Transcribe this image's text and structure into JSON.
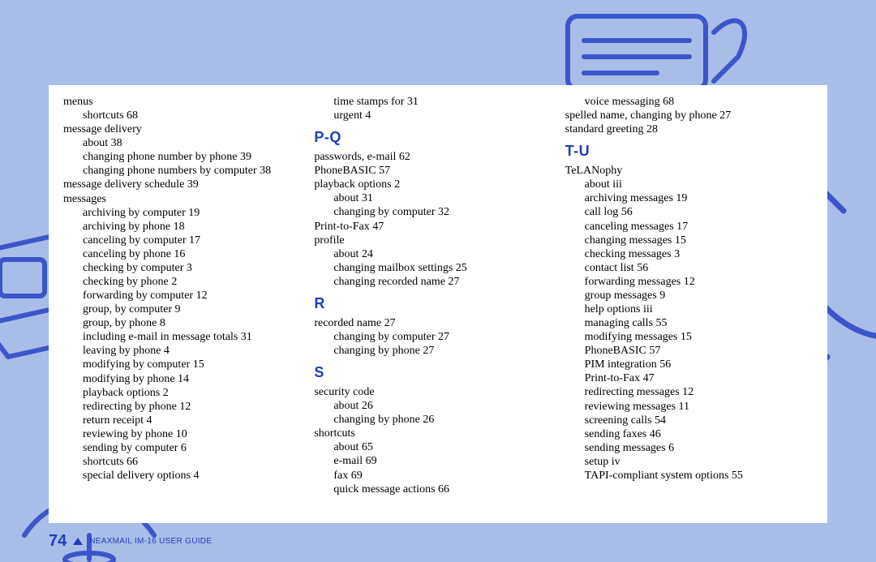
{
  "footer": {
    "pageNumber": "74",
    "guide": "NEAXMAIL IM-16 USER GUIDE"
  },
  "headings": {
    "pq": "P-Q",
    "r": "R",
    "s": "S",
    "tu": "T-U"
  },
  "col1": [
    {
      "text": "menus",
      "indent": 0
    },
    {
      "text": "shortcuts 68",
      "indent": 1
    },
    {
      "text": "message delivery",
      "indent": 0
    },
    {
      "text": "about 38",
      "indent": 1
    },
    {
      "text": "changing phone number by phone 39",
      "indent": 1
    },
    {
      "text": "changing phone numbers by computer 38",
      "indent": 1
    },
    {
      "text": "message delivery schedule 39",
      "indent": 0
    },
    {
      "text": "messages",
      "indent": 0
    },
    {
      "text": "archiving by computer 19",
      "indent": 1
    },
    {
      "text": "archiving by phone 18",
      "indent": 1
    },
    {
      "text": "canceling by computer 17",
      "indent": 1
    },
    {
      "text": "canceling by phone 16",
      "indent": 1
    },
    {
      "text": "checking by computer 3",
      "indent": 1
    },
    {
      "text": "checking by phone 2",
      "indent": 1
    },
    {
      "text": "forwarding by computer 12",
      "indent": 1
    },
    {
      "text": "group, by computer 9",
      "indent": 1
    },
    {
      "text": "group, by phone 8",
      "indent": 1
    },
    {
      "text": "including e-mail in message totals 31",
      "indent": 1
    },
    {
      "text": "leaving by phone 4",
      "indent": 1
    },
    {
      "text": "modifying by computer 15",
      "indent": 1
    },
    {
      "text": "modifying by phone 14",
      "indent": 1
    },
    {
      "text": "playback options 2",
      "indent": 1
    },
    {
      "text": "redirecting by phone 12",
      "indent": 1
    },
    {
      "text": "return receipt 4",
      "indent": 1
    },
    {
      "text": "reviewing by phone 10",
      "indent": 1
    },
    {
      "text": "sending by computer 6",
      "indent": 1
    },
    {
      "text": "shortcuts 66",
      "indent": 1
    },
    {
      "text": "special delivery options 4",
      "indent": 1
    }
  ],
  "col2_a": [
    {
      "text": "time stamps for 31",
      "indent": 1
    },
    {
      "text": "urgent 4",
      "indent": 1
    }
  ],
  "col2_pq": [
    {
      "text": "passwords, e-mail 62",
      "indent": 0
    },
    {
      "text": "PhoneBASIC 57",
      "indent": 0
    },
    {
      "text": "playback options 2",
      "indent": 0
    },
    {
      "text": "about 31",
      "indent": 1
    },
    {
      "text": "changing by computer 32",
      "indent": 1
    },
    {
      "text": "Print-to-Fax 47",
      "indent": 0
    },
    {
      "text": "profile",
      "indent": 0
    },
    {
      "text": "about 24",
      "indent": 1
    },
    {
      "text": "changing mailbox settings 25",
      "indent": 1
    },
    {
      "text": "changing recorded name 27",
      "indent": 1
    }
  ],
  "col2_r": [
    {
      "text": "recorded name 27",
      "indent": 0
    },
    {
      "text": "changing by computer 27",
      "indent": 1
    },
    {
      "text": "changing by phone 27",
      "indent": 1
    }
  ],
  "col2_s": [
    {
      "text": "security code",
      "indent": 0
    },
    {
      "text": "about 26",
      "indent": 1
    },
    {
      "text": "changing by phone 26",
      "indent": 1
    },
    {
      "text": "shortcuts",
      "indent": 0
    },
    {
      "text": "about 65",
      "indent": 1
    },
    {
      "text": "e-mail 69",
      "indent": 1
    },
    {
      "text": "fax 69",
      "indent": 1
    },
    {
      "text": "quick message actions 66",
      "indent": 1
    }
  ],
  "col3_a": [
    {
      "text": "voice messaging 68",
      "indent": 1
    },
    {
      "text": "spelled name, changing by phone 27",
      "indent": 0
    },
    {
      "text": "standard greeting 28",
      "indent": 0
    }
  ],
  "col3_tu": [
    {
      "text": "TeLANophy",
      "indent": 0
    },
    {
      "text": "about iii",
      "indent": 1
    },
    {
      "text": "archiving messages 19",
      "indent": 1
    },
    {
      "text": "call log 56",
      "indent": 1
    },
    {
      "text": "canceling messages 17",
      "indent": 1
    },
    {
      "text": "changing messages 15",
      "indent": 1
    },
    {
      "text": "checking messages 3",
      "indent": 1
    },
    {
      "text": "contact list 56",
      "indent": 1
    },
    {
      "text": "forwarding messages 12",
      "indent": 1
    },
    {
      "text": "group messages 9",
      "indent": 1
    },
    {
      "text": "help options iii",
      "indent": 1
    },
    {
      "text": "managing calls 55",
      "indent": 1
    },
    {
      "text": "modifying messages 15",
      "indent": 1
    },
    {
      "text": "PhoneBASIC 57",
      "indent": 1
    },
    {
      "text": "PIM integration 56",
      "indent": 1
    },
    {
      "text": "Print-to-Fax 47",
      "indent": 1
    },
    {
      "text": "redirecting messages 12",
      "indent": 1
    },
    {
      "text": "reviewing messages 11",
      "indent": 1
    },
    {
      "text": "screening calls 54",
      "indent": 1
    },
    {
      "text": "sending faxes 46",
      "indent": 1
    },
    {
      "text": "sending messages 6",
      "indent": 1
    },
    {
      "text": "setup iv",
      "indent": 1
    },
    {
      "text": "TAPI-compliant system options 55",
      "indent": 1
    }
  ]
}
